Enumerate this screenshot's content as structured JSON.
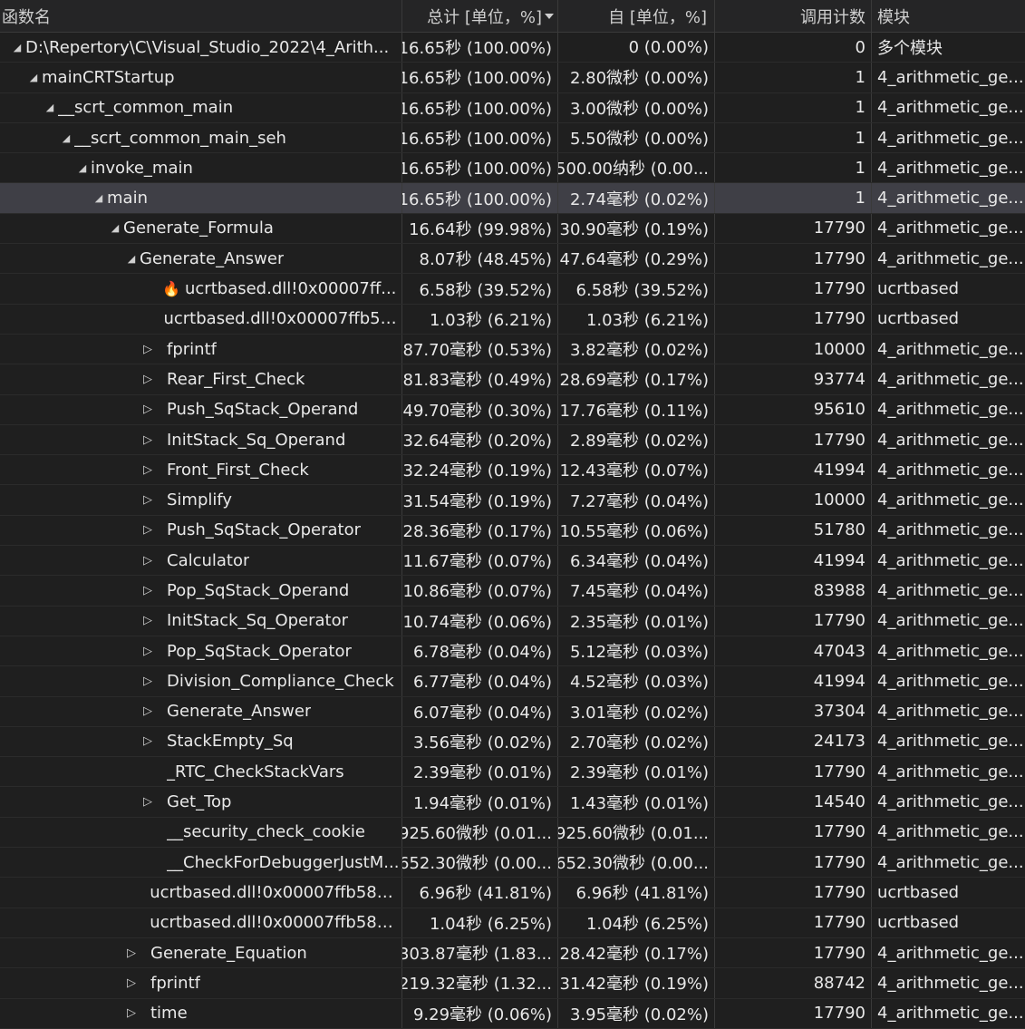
{
  "header": {
    "name": "函数名",
    "total": "总计 [单位，%]",
    "self": "自 [单位，%]",
    "calls": "调用计数",
    "module": "模块"
  },
  "rows": [
    {
      "name": "D:\\Repertory\\C\\Visual_Studio_2022\\4_Arith...",
      "total": "16.65秒 (100.00%)",
      "self": "0 (0.00%)",
      "calls": "0",
      "module": "多个模块"
    },
    {
      "name": "mainCRTStartup",
      "total": "16.65秒 (100.00%)",
      "self": "2.80微秒 (0.00%)",
      "calls": "1",
      "module": "4_arithmetic_ge..."
    },
    {
      "name": "__scrt_common_main",
      "total": "16.65秒 (100.00%)",
      "self": "3.00微秒 (0.00%)",
      "calls": "1",
      "module": "4_arithmetic_ge..."
    },
    {
      "name": "__scrt_common_main_seh",
      "total": "16.65秒 (100.00%)",
      "self": "5.50微秒 (0.00%)",
      "calls": "1",
      "module": "4_arithmetic_ge..."
    },
    {
      "name": "invoke_main",
      "total": "16.65秒 (100.00%)",
      "self": "500.00纳秒 (0.00...",
      "calls": "1",
      "module": "4_arithmetic_ge..."
    },
    {
      "name": "main",
      "total": "16.65秒 (100.00%)",
      "self": "2.74毫秒 (0.02%)",
      "calls": "1",
      "module": "4_arithmetic_ge..."
    },
    {
      "name": "Generate_Formula",
      "total": "16.64秒 (99.98%)",
      "self": "30.90毫秒 (0.19%)",
      "calls": "17790",
      "module": "4_arithmetic_ge..."
    },
    {
      "name": "Generate_Answer",
      "total": "8.07秒 (48.45%)",
      "self": "47.64毫秒 (0.29%)",
      "calls": "17790",
      "module": "4_arithmetic_ge..."
    },
    {
      "name": "ucrtbased.dll!0x00007ff...",
      "total": "6.58秒 (39.52%)",
      "self": "6.58秒 (39.52%)",
      "calls": "17790",
      "module": "ucrtbased"
    },
    {
      "name": "ucrtbased.dll!0x00007ffb58...",
      "total": "1.03秒 (6.21%)",
      "self": "1.03秒 (6.21%)",
      "calls": "17790",
      "module": "ucrtbased"
    },
    {
      "name": "fprintf",
      "total": "87.70毫秒 (0.53%)",
      "self": "3.82毫秒 (0.02%)",
      "calls": "10000",
      "module": "4_arithmetic_ge..."
    },
    {
      "name": "Rear_First_Check",
      "total": "81.83毫秒 (0.49%)",
      "self": "28.69毫秒 (0.17%)",
      "calls": "93774",
      "module": "4_arithmetic_ge..."
    },
    {
      "name": "Push_SqStack_Operand",
      "total": "49.70毫秒 (0.30%)",
      "self": "17.76毫秒 (0.11%)",
      "calls": "95610",
      "module": "4_arithmetic_ge..."
    },
    {
      "name": "InitStack_Sq_Operand",
      "total": "32.64毫秒 (0.20%)",
      "self": "2.89毫秒 (0.02%)",
      "calls": "17790",
      "module": "4_arithmetic_ge..."
    },
    {
      "name": "Front_First_Check",
      "total": "32.24毫秒 (0.19%)",
      "self": "12.43毫秒 (0.07%)",
      "calls": "41994",
      "module": "4_arithmetic_ge..."
    },
    {
      "name": "Simplify",
      "total": "31.54毫秒 (0.19%)",
      "self": "7.27毫秒 (0.04%)",
      "calls": "10000",
      "module": "4_arithmetic_ge..."
    },
    {
      "name": "Push_SqStack_Operator",
      "total": "28.36毫秒 (0.17%)",
      "self": "10.55毫秒 (0.06%)",
      "calls": "51780",
      "module": "4_arithmetic_ge..."
    },
    {
      "name": "Calculator",
      "total": "11.67毫秒 (0.07%)",
      "self": "6.34毫秒 (0.04%)",
      "calls": "41994",
      "module": "4_arithmetic_ge..."
    },
    {
      "name": "Pop_SqStack_Operand",
      "total": "10.86毫秒 (0.07%)",
      "self": "7.45毫秒 (0.04%)",
      "calls": "83988",
      "module": "4_arithmetic_ge..."
    },
    {
      "name": "InitStack_Sq_Operator",
      "total": "10.74毫秒 (0.06%)",
      "self": "2.35毫秒 (0.01%)",
      "calls": "17790",
      "module": "4_arithmetic_ge..."
    },
    {
      "name": "Pop_SqStack_Operator",
      "total": "6.78毫秒 (0.04%)",
      "self": "5.12毫秒 (0.03%)",
      "calls": "47043",
      "module": "4_arithmetic_ge..."
    },
    {
      "name": "Division_Compliance_Check",
      "total": "6.77毫秒 (0.04%)",
      "self": "4.52毫秒 (0.03%)",
      "calls": "41994",
      "module": "4_arithmetic_ge..."
    },
    {
      "name": "Generate_Answer",
      "total": "6.07毫秒 (0.04%)",
      "self": "3.01毫秒 (0.02%)",
      "calls": "37304",
      "module": "4_arithmetic_ge..."
    },
    {
      "name": "StackEmpty_Sq",
      "total": "3.56毫秒 (0.02%)",
      "self": "2.70毫秒 (0.02%)",
      "calls": "24173",
      "module": "4_arithmetic_ge..."
    },
    {
      "name": "_RTC_CheckStackVars",
      "total": "2.39毫秒 (0.01%)",
      "self": "2.39毫秒 (0.01%)",
      "calls": "17790",
      "module": "4_arithmetic_ge..."
    },
    {
      "name": "Get_Top",
      "total": "1.94毫秒 (0.01%)",
      "self": "1.43毫秒 (0.01%)",
      "calls": "14540",
      "module": "4_arithmetic_ge..."
    },
    {
      "name": "__security_check_cookie",
      "total": "925.60微秒 (0.01...",
      "self": "925.60微秒 (0.01...",
      "calls": "17790",
      "module": "4_arithmetic_ge..."
    },
    {
      "name": "__CheckForDebuggerJustM...",
      "total": "652.30微秒 (0.00...",
      "self": "652.30微秒 (0.00...",
      "calls": "17790",
      "module": "4_arithmetic_ge..."
    },
    {
      "name": "ucrtbased.dll!0x00007ffb582...",
      "total": "6.96秒 (41.81%)",
      "self": "6.96秒 (41.81%)",
      "calls": "17790",
      "module": "ucrtbased"
    },
    {
      "name": "ucrtbased.dll!0x00007ffb582...",
      "total": "1.04秒 (6.25%)",
      "self": "1.04秒 (6.25%)",
      "calls": "17790",
      "module": "ucrtbased"
    },
    {
      "name": "Generate_Equation",
      "total": "303.87毫秒 (1.83...",
      "self": "28.42毫秒 (0.17%)",
      "calls": "17790",
      "module": "4_arithmetic_ge..."
    },
    {
      "name": "fprintf",
      "total": "219.32毫秒 (1.32...",
      "self": "31.42毫秒 (0.19%)",
      "calls": "88742",
      "module": "4_arithmetic_ge..."
    },
    {
      "name": "time",
      "total": "9.29毫秒 (0.06%)",
      "self": "3.95毫秒 (0.02%)",
      "calls": "17790",
      "module": "4_arithmetic_ge..."
    }
  ]
}
